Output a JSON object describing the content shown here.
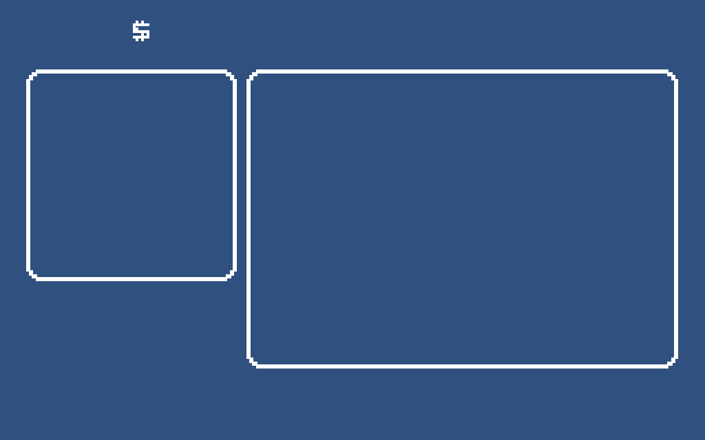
{
  "hud": {
    "currency_glyph": "$",
    "currency_icon": "dollar-sign-icon"
  },
  "panels": {
    "left": {
      "name": "left-panel",
      "content": ""
    },
    "right": {
      "name": "right-panel",
      "content": ""
    }
  },
  "colors": {
    "background": "#30517f",
    "border": "#ffffff"
  }
}
